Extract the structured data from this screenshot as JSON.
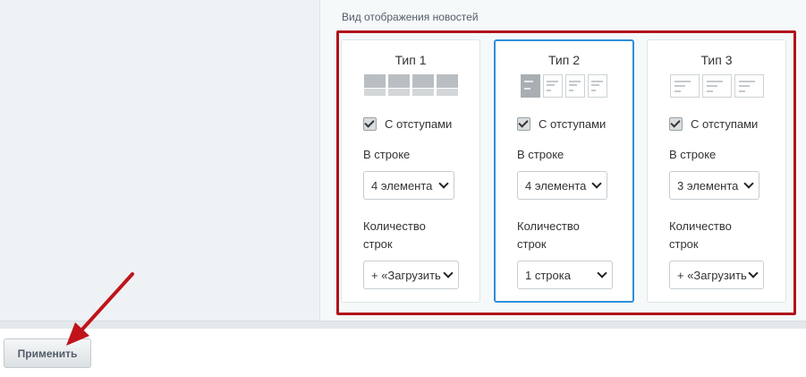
{
  "section": {
    "title": "Вид отображения новостей"
  },
  "cards": [
    {
      "title": "Тип 1",
      "checkbox_label": "С отступами",
      "per_row_label": "В строке",
      "per_row_value": "4 элемента",
      "rows_label_line1": "Количество",
      "rows_label_line2": "строк",
      "rows_value": "+ «Загрузить",
      "selected": false
    },
    {
      "title": "Тип 2",
      "checkbox_label": "С отступами",
      "per_row_label": "В строке",
      "per_row_value": "4 элемента",
      "rows_label_line1": "Количество",
      "rows_label_line2": "строк",
      "rows_value": "1 строка",
      "selected": true
    },
    {
      "title": "Тип 3",
      "checkbox_label": "С отступами",
      "per_row_label": "В строке",
      "per_row_value": "3 элемента",
      "rows_label_line1": "Количество",
      "rows_label_line2": "строк",
      "rows_value": "+ «Загрузить",
      "selected": false
    }
  ],
  "footer": {
    "apply_label": "Применить"
  },
  "colors": {
    "highlight": "#b0141a",
    "selected_border": "#2f8fda",
    "arrow": "#c0141a"
  }
}
